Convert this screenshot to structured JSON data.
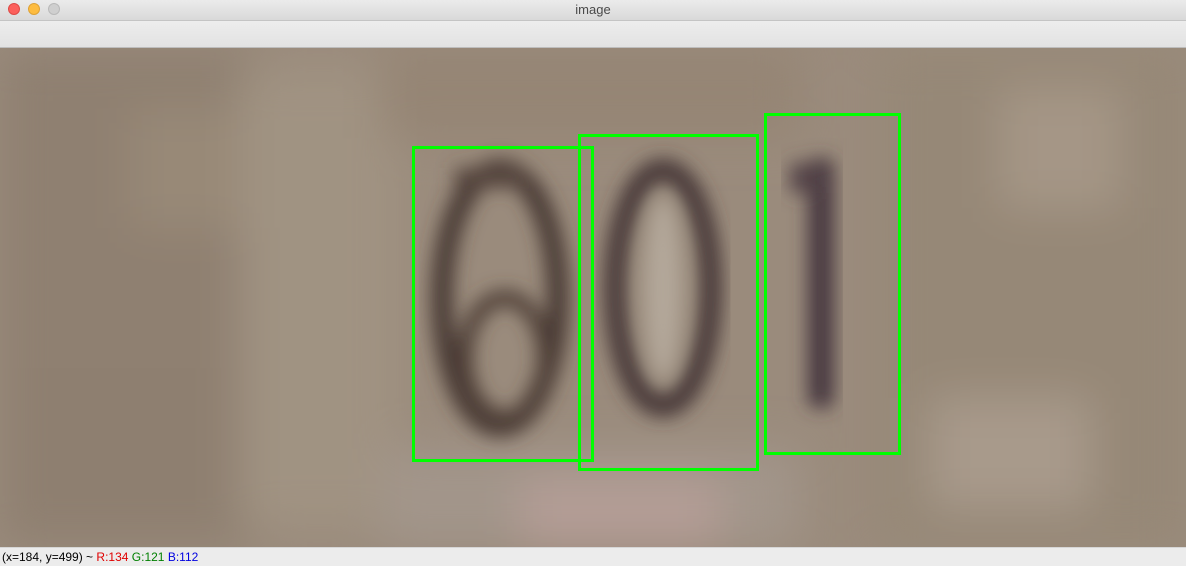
{
  "window": {
    "title": "image"
  },
  "icons": {
    "close": "close-traffic-light-icon",
    "minimize": "minimize-traffic-light-icon",
    "zoom": "zoom-traffic-light-icon"
  },
  "image": {
    "description_hidden": "",
    "digits_shown": [
      "6",
      "0",
      "1"
    ],
    "box_color": "#00ff00",
    "box_count": 3
  },
  "status": {
    "coords": "(x=184, y=499) ~ ",
    "r_label": "R:134",
    "g_label": "G:121",
    "b_label": "B:112",
    "r_color": "#e00000",
    "g_color": "#008000",
    "b_color": "#0000e0"
  }
}
